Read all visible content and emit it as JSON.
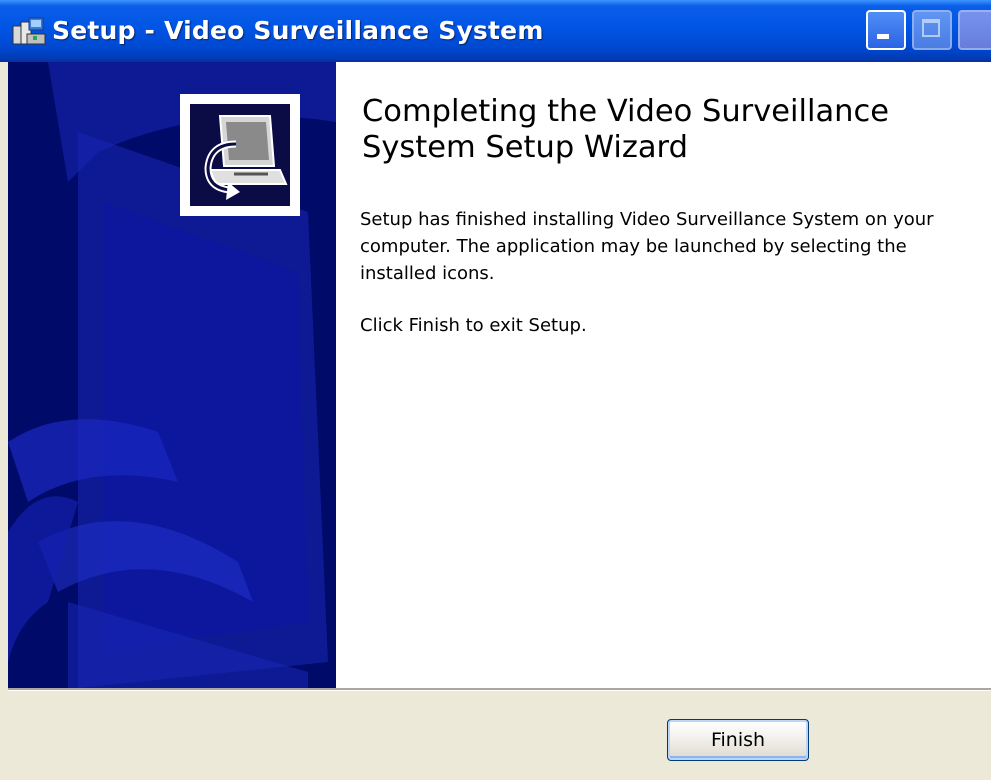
{
  "window": {
    "title": "Setup - Video Surveillance System",
    "title_icon": "setup-installer-icon"
  },
  "title_buttons": {
    "minimize_icon": "minimize-icon",
    "maximize_icon": "maximize-icon",
    "close_icon": "close-icon"
  },
  "wizard": {
    "heading": "Completing the Video Surveillance System Setup Wizard",
    "paragraph1": "Setup has finished installing Video Surveillance System on your computer. The application may be launched by selecting the installed icons.",
    "paragraph2": "Click Finish to exit Setup.",
    "logo_icon": "computer-install-icon"
  },
  "buttons": {
    "finish_label": "Finish"
  },
  "colors": {
    "titlebar": "#0055e5",
    "side_panel": "#000a68",
    "dialog_bg": "#ece9d8"
  }
}
